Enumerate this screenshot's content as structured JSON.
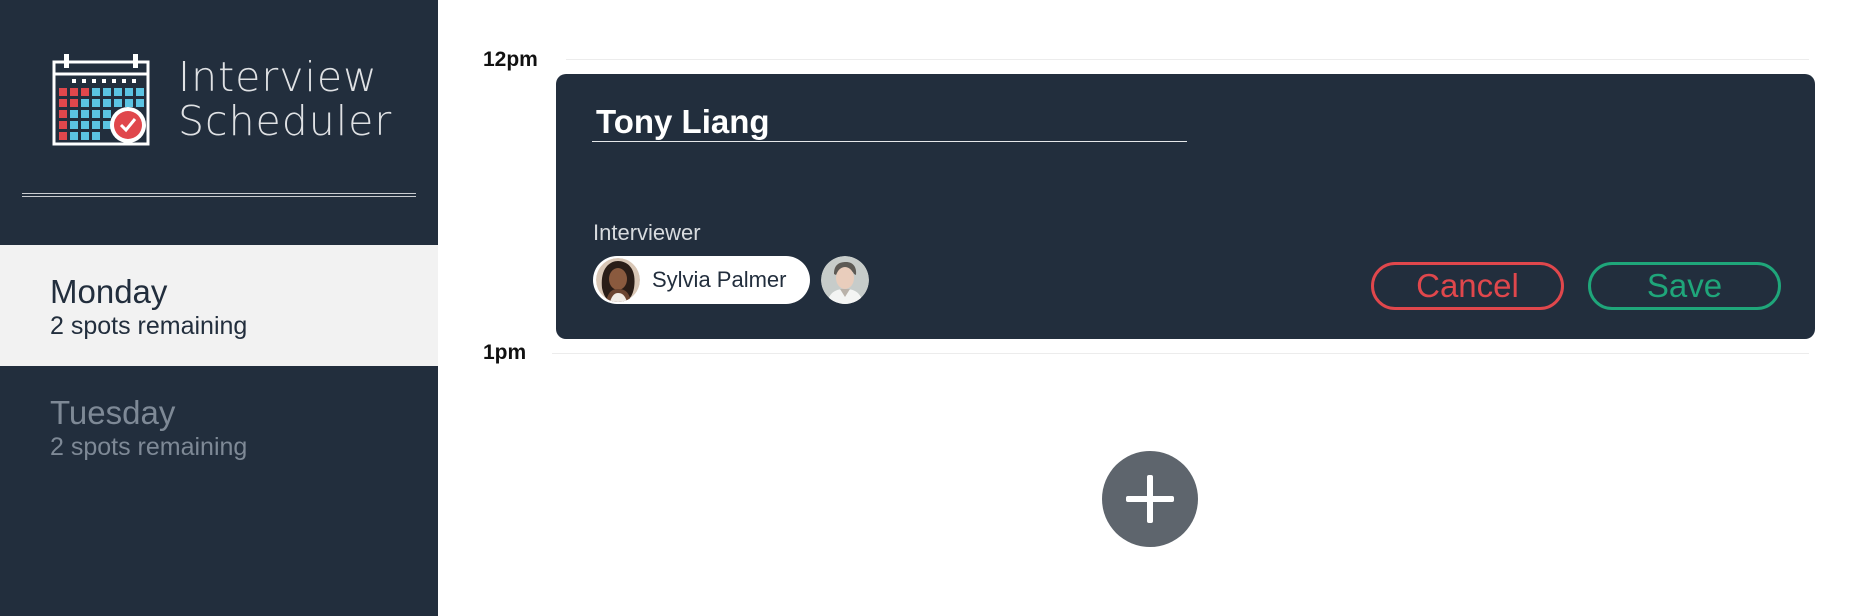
{
  "app": {
    "title_line1": "Interview",
    "title_line2": "Scheduler",
    "logo_icon": "calendar-check-icon"
  },
  "days": [
    {
      "name": "Monday",
      "spots": "2 spots remaining",
      "selected": true
    },
    {
      "name": "Tuesday",
      "spots": "2 spots remaining",
      "selected": false
    }
  ],
  "schedule": {
    "times": [
      "12pm",
      "1pm"
    ],
    "form": {
      "student_name": "Tony Liang",
      "interviewer_heading": "Interviewer",
      "interviewers": [
        {
          "name": "Sylvia Palmer",
          "selected": true,
          "avatar": "avatar-photo"
        },
        {
          "name": "",
          "selected": false,
          "avatar": "avatar-photo"
        }
      ],
      "cancel_label": "Cancel",
      "save_label": "Save"
    },
    "add_button_icon": "plus-icon"
  },
  "colors": {
    "sidebar_bg": "#222e3d",
    "selected_day_bg": "#f2f2f2",
    "cancel": "#e0474c",
    "save": "#1fa67a",
    "add_button": "#5e656d"
  }
}
